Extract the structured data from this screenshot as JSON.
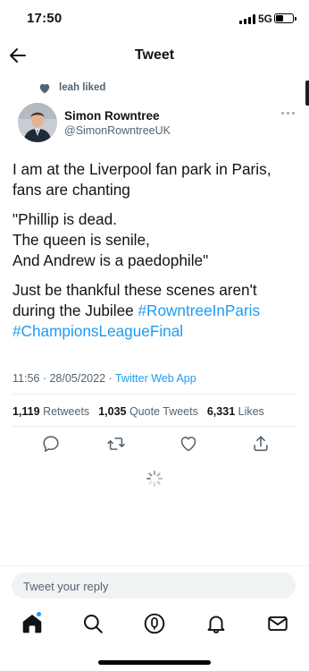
{
  "status_bar": {
    "time": "17:50",
    "network": "5G",
    "battery_level": 0.45
  },
  "header": {
    "title": "Tweet"
  },
  "social_context": {
    "text": "leah liked"
  },
  "author": {
    "name": "Simon Rowntree",
    "handle": "@SimonRowntreeUK"
  },
  "tweet": {
    "para1_line1": "I am at the Liverpool fan park in Paris,",
    "para1_line2": "fans are chanting",
    "para2_line1": "\"Phillip is dead.",
    "para2_line2": "The queen is senile,",
    "para2_line3": "And Andrew is a paedophile\"",
    "para3_line1": "Just be thankful these scenes aren't",
    "para3_line2_text": "during the Jubilee ",
    "hashtag1": "#RowntreeInParis",
    "hashtag2": "#ChampionsLeagueFinal"
  },
  "meta": {
    "time": "11:56",
    "separator": " · ",
    "date": "28/05/2022",
    "source": "Twitter Web App"
  },
  "stats": {
    "retweets_count": "1,119",
    "retweets_label": "Retweets",
    "quotes_count": "1,035",
    "quotes_label": "Quote Tweets",
    "likes_count": "6,331",
    "likes_label": "Likes"
  },
  "reply": {
    "placeholder": "Tweet your reply"
  },
  "icons": {
    "back": "arrow-left-icon",
    "more": "more-icon",
    "reply": "reply-icon",
    "retweet": "retweet-icon",
    "like": "heart-icon",
    "share": "share-icon",
    "home": "home-icon",
    "search": "search-icon",
    "spaces": "spaces-icon",
    "notifications": "bell-icon",
    "messages": "mail-icon"
  },
  "colors": {
    "accent": "#1d9bf0",
    "text": "#0f1419",
    "secondary": "#536471",
    "liked_heart": "#536471"
  }
}
